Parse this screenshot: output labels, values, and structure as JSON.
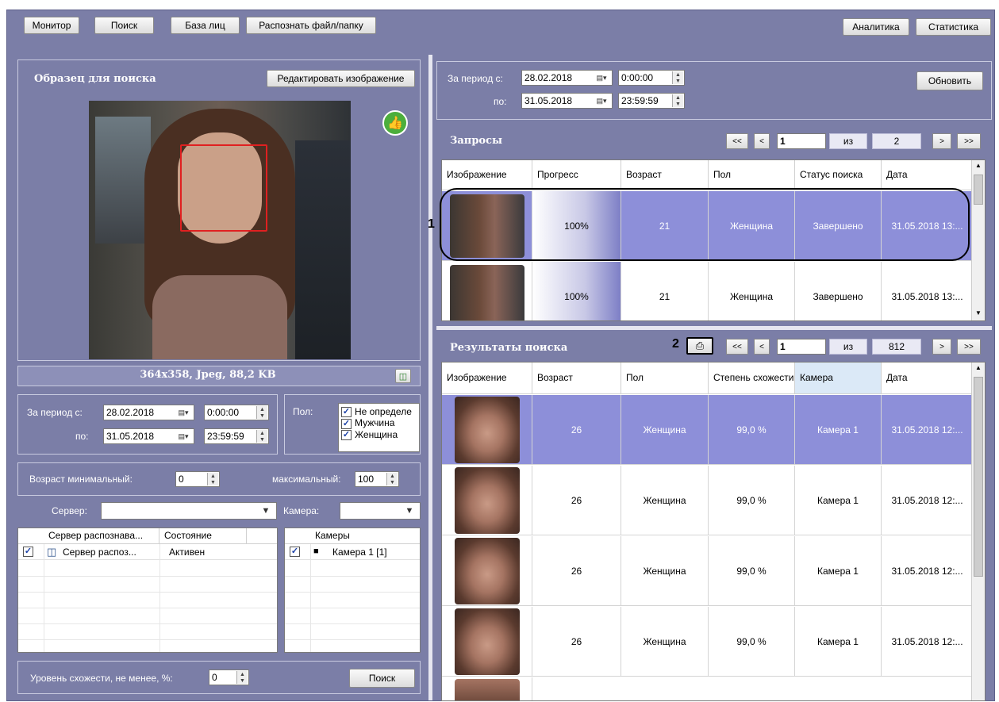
{
  "toolbar": {
    "monitor": "Монитор",
    "search": "Поиск",
    "face_db": "База лиц",
    "recognize": "Распознать файл/папку",
    "analytics": "Аналитика",
    "statistics": "Статистика"
  },
  "sample": {
    "title": "Образец для поиска",
    "edit_button": "Редактировать изображение",
    "image_info": "364x358, Jpeg, 88,2 KB"
  },
  "left_period": {
    "from_label": "За период с:",
    "to_label": "по:",
    "from_date": "28.02.2018",
    "from_time": "0:00:00",
    "to_date": "31.05.2018",
    "to_time": "23:59:59"
  },
  "gender_filter": {
    "label": "Пол:",
    "options": [
      "Не определе",
      "Мужчина",
      "Женщина"
    ]
  },
  "age": {
    "min_label": "Возраст минимальный:",
    "min_value": "0",
    "max_label": "максимальный:",
    "max_value": "100"
  },
  "server_filter": {
    "server_label": "Сервер:",
    "server_value": "",
    "camera_label": "Камера:",
    "camera_value": ""
  },
  "servers_table": {
    "headers": [
      "Сервер распознава...",
      "Состояние"
    ],
    "rows": [
      {
        "name": "Сервер распоз...",
        "state": "Активен"
      }
    ]
  },
  "cameras_table": {
    "header": "Камеры",
    "rows": [
      {
        "name": "Камера 1 [1]"
      }
    ]
  },
  "similarity": {
    "label": "Уровень схожести, не менее, %:",
    "value": "0",
    "search_button": "Поиск"
  },
  "right_period": {
    "from_label": "За период с:",
    "to_label": "по:",
    "from_date": "28.02.2018",
    "from_time": "0:00:00",
    "to_date": "31.05.2018",
    "to_time": "23:59:59",
    "refresh": "Обновить"
  },
  "requests": {
    "title": "Запросы",
    "pager": {
      "first": "<<",
      "prev": "<",
      "page": "1",
      "of": "из",
      "total": "2",
      "next": ">",
      "last": ">>"
    },
    "headers": [
      "Изображение",
      "Прогресс",
      "Возраст",
      "Пол",
      "Статус поиска",
      "Дата"
    ],
    "rows": [
      {
        "progress": "100%",
        "age": "21",
        "gender": "Женщина",
        "status": "Завершено",
        "date": "31.05.2018 13:..."
      },
      {
        "progress": "100%",
        "age": "21",
        "gender": "Женщина",
        "status": "Завершено",
        "date": "31.05.2018 13:..."
      }
    ]
  },
  "results": {
    "title": "Результаты поиска",
    "pager": {
      "first": "<<",
      "prev": "<",
      "page": "1",
      "of": "из",
      "total": "812",
      "next": ">",
      "last": ">>"
    },
    "headers": [
      "Изображение",
      "Возраст",
      "Пол",
      "Степень схожести",
      "Камера",
      "Дата"
    ],
    "rows": [
      {
        "age": "26",
        "gender": "Женщина",
        "similarity": "99,0 %",
        "camera": "Камера 1",
        "date": "31.05.2018 12:..."
      },
      {
        "age": "26",
        "gender": "Женщина",
        "similarity": "99,0 %",
        "camera": "Камера 1",
        "date": "31.05.2018 12:..."
      },
      {
        "age": "26",
        "gender": "Женщина",
        "similarity": "99,0 %",
        "camera": "Камера 1",
        "date": "31.05.2018 12:..."
      },
      {
        "age": "26",
        "gender": "Женщина",
        "similarity": "99,0 %",
        "camera": "Камера 1",
        "date": "31.05.2018 12:..."
      }
    ]
  },
  "callouts": {
    "one": "1",
    "two": "2"
  },
  "colors": {
    "window_bg": "#7b7ea7",
    "selected_row": "#8d8fd9",
    "like_green": "#4cae3c"
  }
}
